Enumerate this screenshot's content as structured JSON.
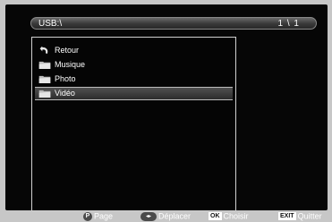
{
  "header": {
    "path": "USB:\\",
    "page_count": "1 \\ 1"
  },
  "list": {
    "items": [
      {
        "label": "Retour",
        "icon": "back-arrow-icon",
        "selected": false
      },
      {
        "label": "Musique",
        "icon": "folder-icon",
        "selected": false
      },
      {
        "label": "Photo",
        "icon": "folder-icon",
        "selected": false
      },
      {
        "label": "Vidéo",
        "icon": "folder-icon",
        "selected": true
      }
    ]
  },
  "footer": {
    "page": {
      "key": "P",
      "label": "Page"
    },
    "move": {
      "key": "◂▸",
      "label": "Déplacer"
    },
    "choose": {
      "key": "OK",
      "label": "Choisir"
    },
    "quit": {
      "key": "EXIT",
      "label": "Quitter"
    }
  },
  "colors": {
    "background": "#c7c7c7",
    "screen": "#060606",
    "text": "#ffffff"
  }
}
